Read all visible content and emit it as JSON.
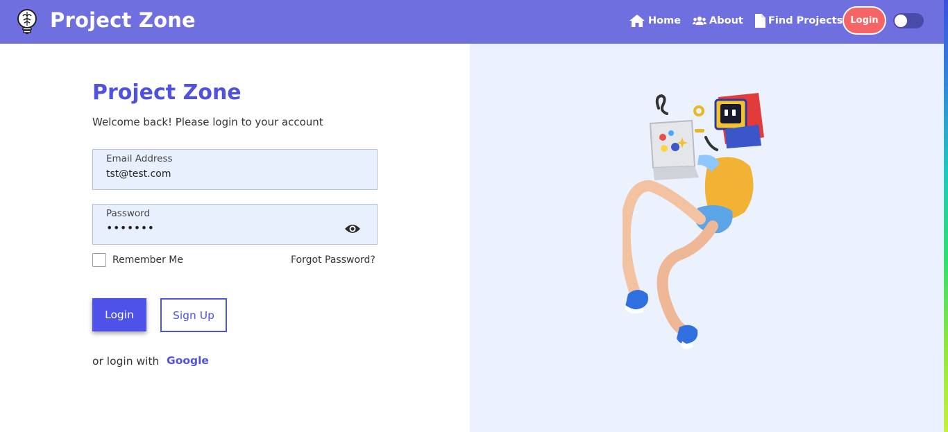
{
  "navbar": {
    "brand": "Project Zone",
    "links": [
      {
        "label": "Home",
        "icon": "home-icon"
      },
      {
        "label": "About",
        "icon": "users-icon"
      },
      {
        "label": "Find Projects",
        "icon": "file-icon"
      }
    ],
    "login_label": "Login",
    "theme_toggle": {
      "on": false
    },
    "background_color": "#6f6fe0",
    "login_color": "#f56565"
  },
  "form": {
    "title": "Project Zone",
    "subtitle": "Welcome back! Please login to your account",
    "email": {
      "label": "Email Address",
      "value": "tst@test.com"
    },
    "password": {
      "label": "Password",
      "value": "•••••••",
      "icon": "eye-icon"
    },
    "remember_label": "Remember Me",
    "forgot_label": "Forgot Password?",
    "login_button": "Login",
    "signup_button": "Sign Up",
    "or_login_with": "or login with",
    "google_label": "Google",
    "accent_color": "#4f52e0"
  },
  "illustration": {
    "icon": "character-with-laptop-illustration",
    "background_color": "#ebf1fd"
  }
}
